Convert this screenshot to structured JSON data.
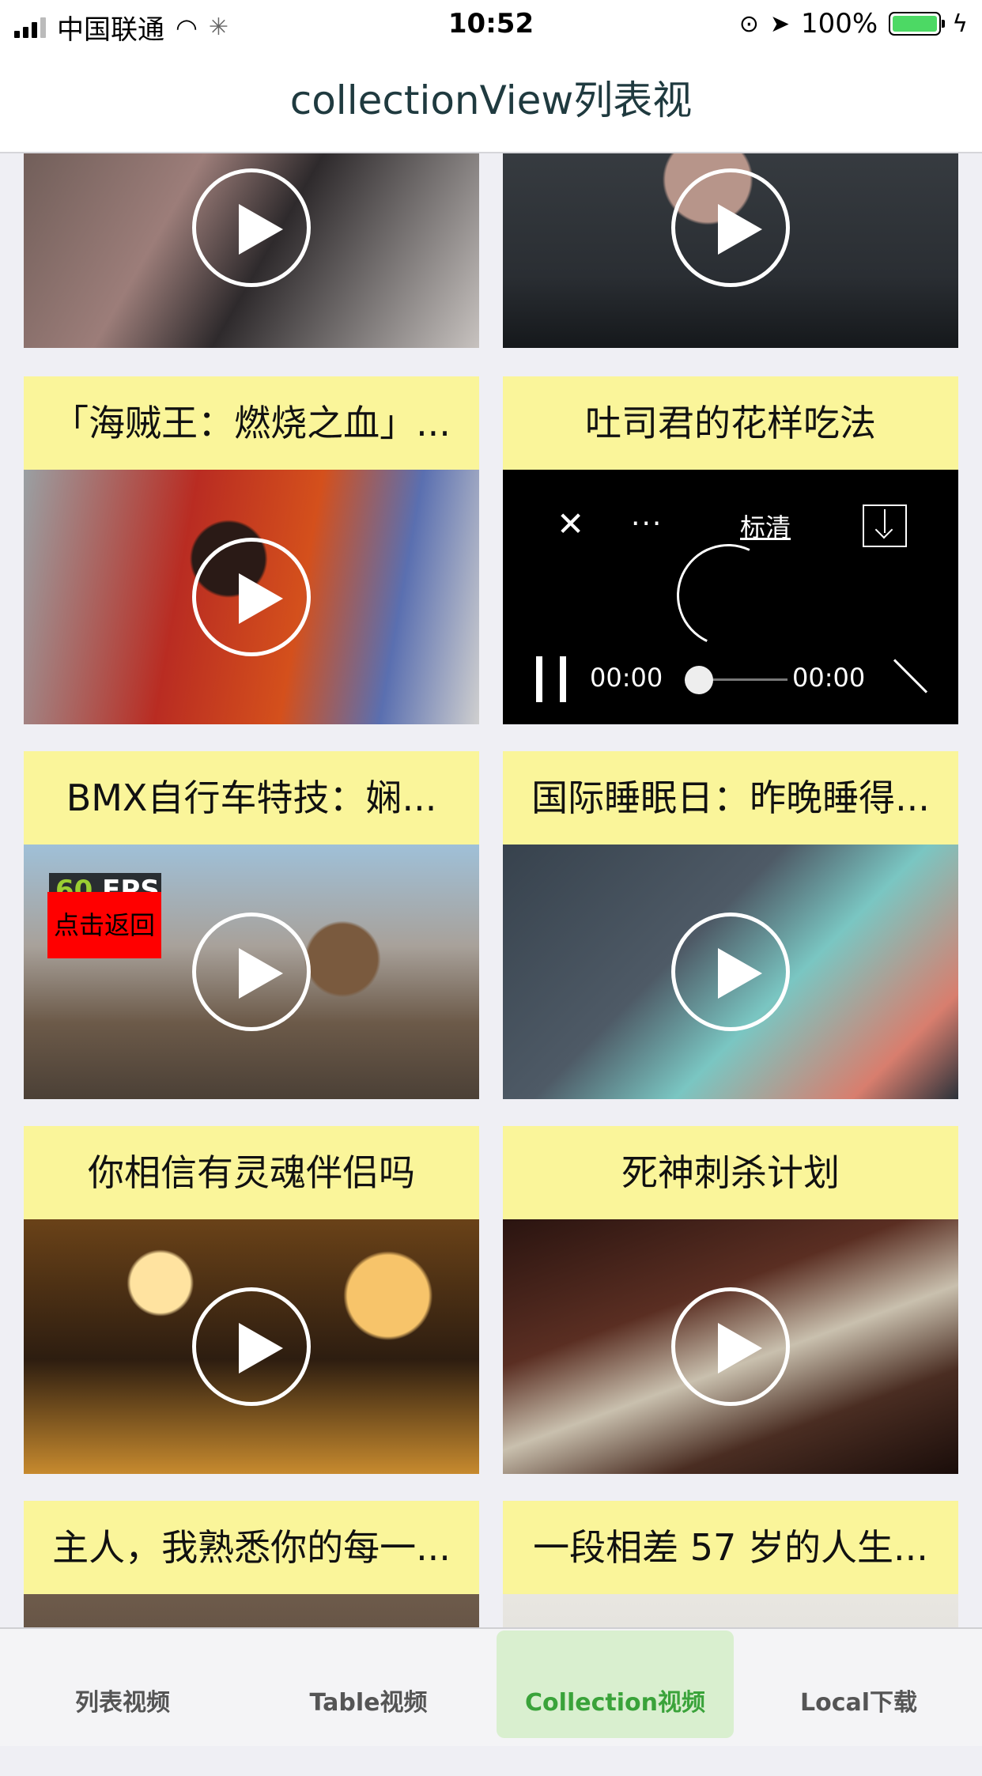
{
  "status_bar": {
    "carrier": "中国联通",
    "time": "10:52",
    "battery": "100%",
    "battery_color": "#4cd964"
  },
  "nav": {
    "title": "collectionView列表视"
  },
  "fps_overlay": {
    "value": "60",
    "unit": "FPS"
  },
  "back_button": {
    "label": "点击返回"
  },
  "cells": [
    {
      "title": "",
      "thumb_theme": "crowd-clipboard"
    },
    {
      "title": "",
      "thumb_theme": "man-at-laptop"
    },
    {
      "title": "「海贼王：燃烧之血」...",
      "thumb_theme": "anime-pirate"
    },
    {
      "title": "吐司君的花样吃法",
      "thumb_theme": "video-player"
    },
    {
      "title": "BMX自行车特技：娴...",
      "thumb_theme": "bmx-rider"
    },
    {
      "title": "国际睡眠日：昨晚睡得...",
      "thumb_theme": "illustration-sleep"
    },
    {
      "title": "你相信有灵魂伴侣吗",
      "thumb_theme": "night-crowd"
    },
    {
      "title": "死神刺杀计划",
      "thumb_theme": "comic-knife"
    },
    {
      "title": "主人，我熟悉你的每一...",
      "thumb_theme": "dog"
    },
    {
      "title": "一段相差 57 岁的人生...",
      "thumb_theme": "light-room"
    }
  ],
  "player": {
    "quality": "标清",
    "more": "...",
    "current_time": "00:00",
    "total_time": "00:00",
    "progress": 0
  },
  "tabs": [
    {
      "label": "列表视频",
      "active": false
    },
    {
      "label": "Table视频",
      "active": false
    },
    {
      "label": "Collection视频",
      "active": true
    },
    {
      "label": "Local下载",
      "active": false
    }
  ],
  "accent_color": "#3aa33a",
  "title_bg_color": "#faf59a"
}
